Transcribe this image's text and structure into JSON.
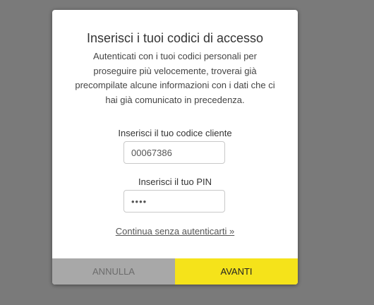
{
  "modal": {
    "title": "Inserisci i tuoi codici di accesso",
    "description": "Autenticati con i tuoi codici personali per proseguire più velocemente, troverai già precompilate alcune informazioni con i dati che ci hai già comunicato in precedenza."
  },
  "form": {
    "client_code_label": "Inserisci il tuo codice cliente",
    "client_code_value": "00067386",
    "pin_label": "Inserisci il tuo PIN",
    "pin_value": "1234"
  },
  "continue_link": "Continua senza autenticarti »",
  "buttons": {
    "cancel": "ANNULLA",
    "next": "AVANTI"
  },
  "colors": {
    "next_button": "#f5e31a",
    "cancel_button": "#a8a8a8",
    "backdrop": "#7a7a7a"
  }
}
